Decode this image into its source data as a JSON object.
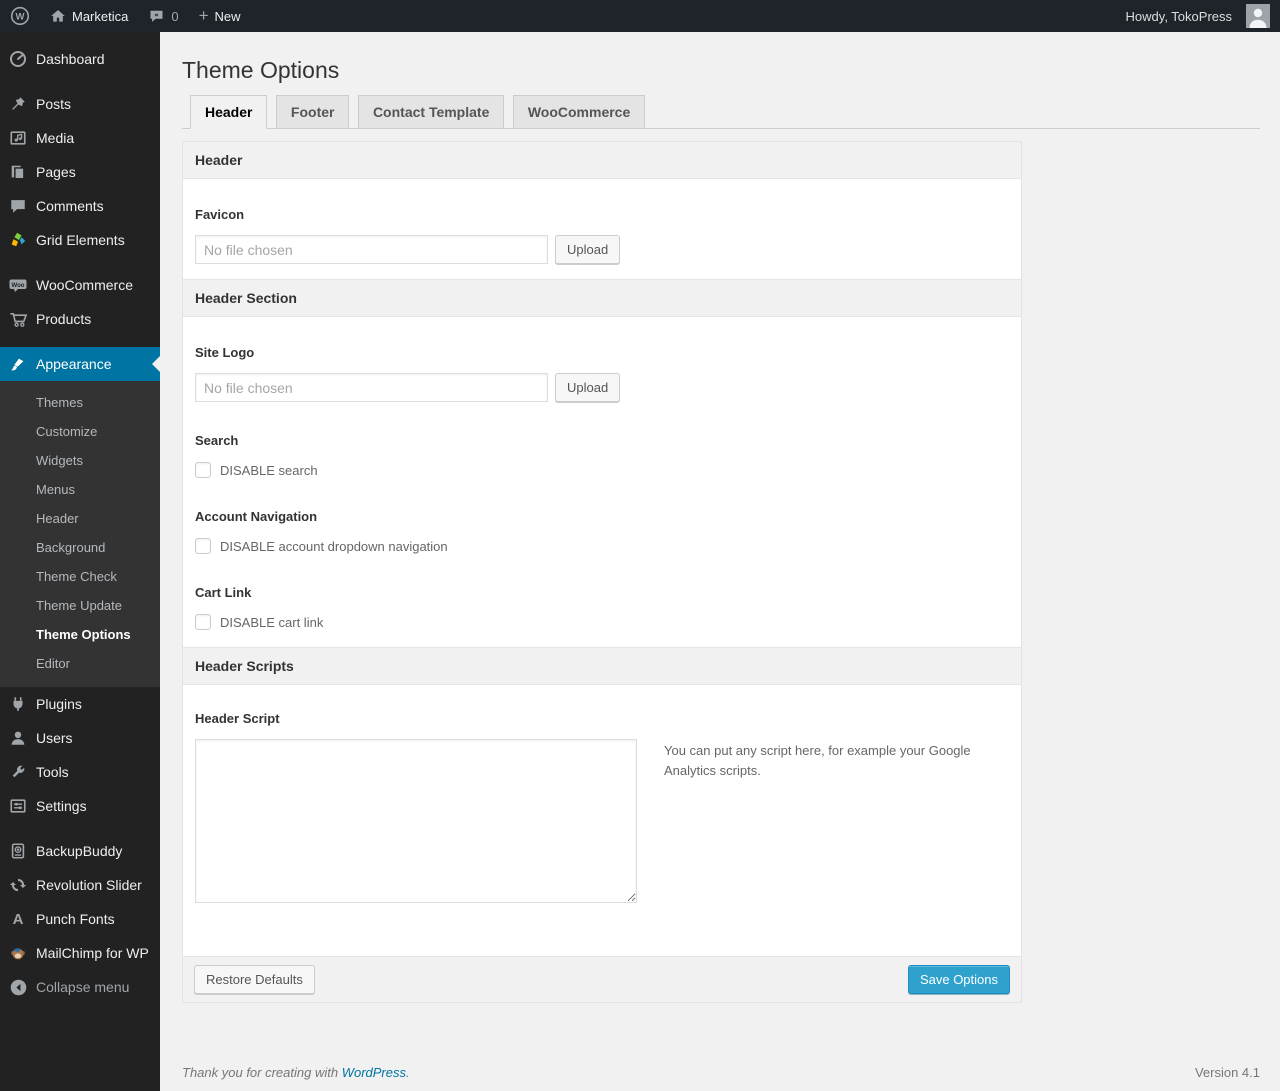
{
  "admin_bar": {
    "site_name": "Marketica",
    "comment_count": "0",
    "plus": "+",
    "new_label": "New",
    "howdy_text": "Howdy, TokoPress"
  },
  "sidebar": {
    "top_items": [
      {
        "label": "Dashboard"
      },
      {
        "label": "Posts"
      },
      {
        "label": "Media"
      },
      {
        "label": "Pages"
      },
      {
        "label": "Comments"
      },
      {
        "label": "Grid Elements"
      },
      {
        "label": "WooCommerce"
      },
      {
        "label": "Products"
      }
    ],
    "appearance": {
      "label": "Appearance",
      "submenu": [
        {
          "label": "Themes"
        },
        {
          "label": "Customize"
        },
        {
          "label": "Widgets"
        },
        {
          "label": "Menus"
        },
        {
          "label": "Header"
        },
        {
          "label": "Background"
        },
        {
          "label": "Theme Check"
        },
        {
          "label": "Theme Update"
        },
        {
          "label": "Theme Options"
        },
        {
          "label": "Editor"
        }
      ]
    },
    "bottom_items": [
      {
        "label": "Plugins"
      },
      {
        "label": "Users"
      },
      {
        "label": "Tools"
      },
      {
        "label": "Settings"
      },
      {
        "label": "BackupBuddy"
      },
      {
        "label": "Revolution Slider"
      },
      {
        "label": "Punch Fonts"
      },
      {
        "label": "MailChimp for WP"
      }
    ],
    "collapse_label": "Collapse menu",
    "punch_fonts_glyph": "A"
  },
  "page": {
    "title": "Theme Options",
    "tabs": [
      {
        "label": "Header"
      },
      {
        "label": "Footer"
      },
      {
        "label": "Contact Template"
      },
      {
        "label": "WooCommerce"
      }
    ]
  },
  "panel": {
    "section_header_1": "Header",
    "favicon": {
      "label": "Favicon",
      "placeholder": "No file chosen",
      "upload_label": "Upload"
    },
    "section_header_2": "Header Section",
    "site_logo": {
      "label": "Site Logo",
      "placeholder": "No file chosen",
      "upload_label": "Upload"
    },
    "search": {
      "label": "Search",
      "checkbox_label": "DISABLE search"
    },
    "account_nav": {
      "label": "Account Navigation",
      "checkbox_label": "DISABLE account dropdown navigation"
    },
    "cart_link": {
      "label": "Cart Link",
      "checkbox_label": "DISABLE cart link"
    },
    "section_header_3": "Header Scripts",
    "header_script": {
      "label": "Header Script",
      "hint": "You can put any script here, for example your Google Analytics scripts."
    },
    "restore_label": "Restore Defaults",
    "save_label": "Save Options"
  },
  "footer": {
    "thanks_prefix": "Thank you for creating with ",
    "wordpress_link": "WordPress",
    "thanks_suffix": ".",
    "version": "Version 4.1"
  },
  "icons": {
    "wordpress_logo": "W",
    "colors": {
      "menu_background": "#222222",
      "submenu_background": "#333333",
      "active_menu": "#0074a2",
      "primary_button": "#2ea2cc",
      "icon_gray": "#a0a5aa"
    }
  }
}
